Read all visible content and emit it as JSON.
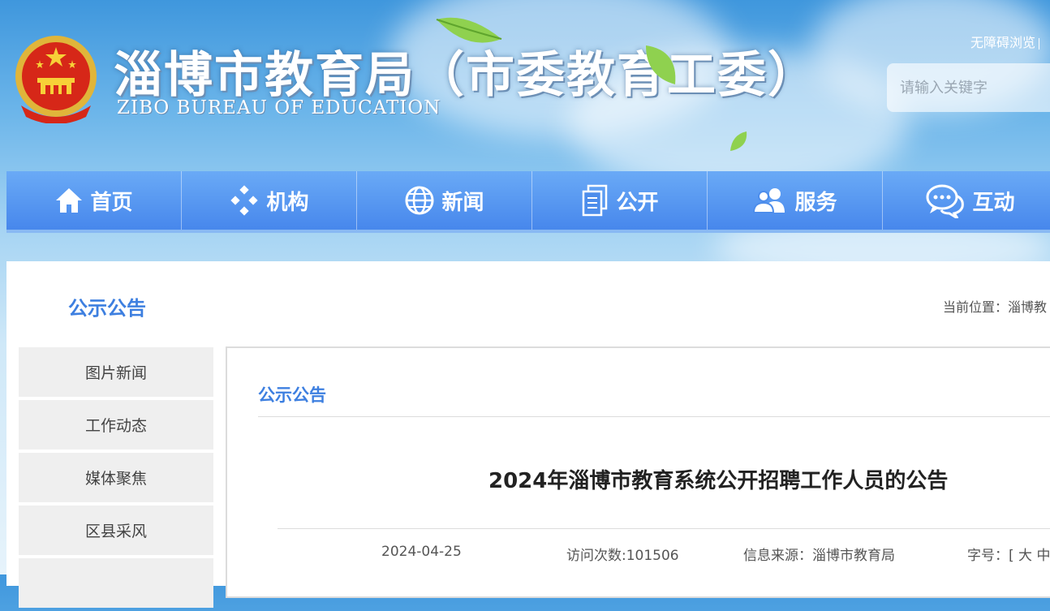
{
  "header": {
    "title": "淄博市教育局（市委教育工委）",
    "subtitle": "ZIBO BUREAU OF EDUCATION",
    "accessibility_label": "无障碍浏览",
    "search_placeholder": "请输入关键字"
  },
  "nav": {
    "items": [
      {
        "label": "首页",
        "icon": "home-icon"
      },
      {
        "label": "机构",
        "icon": "diamonds-icon"
      },
      {
        "label": "新闻",
        "icon": "globe-icon"
      },
      {
        "label": "公开",
        "icon": "documents-icon"
      },
      {
        "label": "服务",
        "icon": "users-icon"
      },
      {
        "label": "互动",
        "icon": "chat-icon"
      }
    ]
  },
  "page": {
    "section_title": "公示公告",
    "breadcrumb": "当前位置：淄博教"
  },
  "sidebar": {
    "items": [
      {
        "label": "图片新闻"
      },
      {
        "label": "工作动态"
      },
      {
        "label": "媒体聚焦"
      },
      {
        "label": "区县采风"
      }
    ]
  },
  "article": {
    "category": "公示公告",
    "title": "2024年淄博市教育系统公开招聘工作人员的公告",
    "date": "2024-04-25",
    "visits": "访问次数:101506",
    "source": "信息来源：淄博市教育局",
    "font_size": "字号：[ 大 中"
  },
  "colors": {
    "nav_blue": "#4787ec",
    "accent_blue": "#3d7fe0"
  }
}
